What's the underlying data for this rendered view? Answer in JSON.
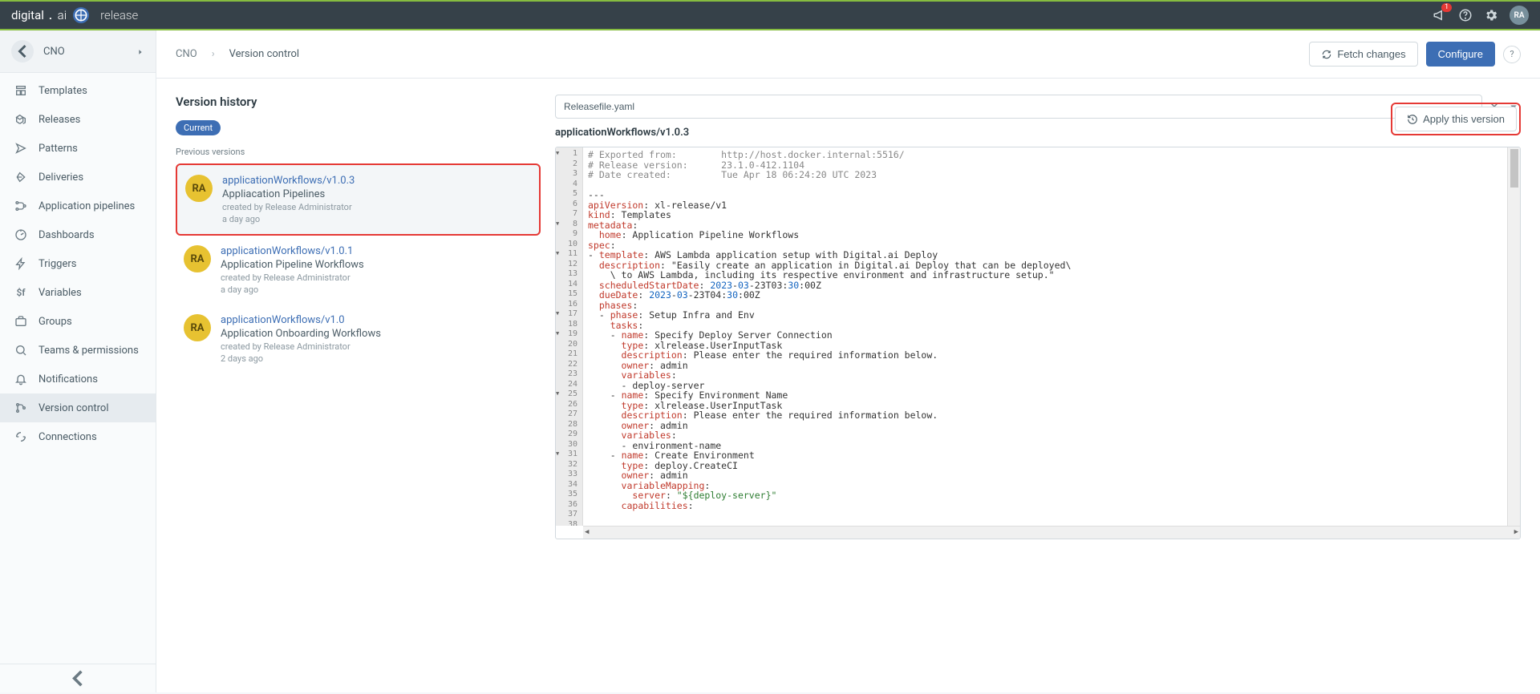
{
  "brand": {
    "product": "digital",
    "dot": ".",
    "ai": "ai",
    "module": "release"
  },
  "topbar": {
    "badge": "1",
    "avatar": "RA"
  },
  "project": {
    "name": "CNO"
  },
  "sidebar": {
    "items": [
      {
        "label": "Templates",
        "icon": "templates-icon"
      },
      {
        "label": "Releases",
        "icon": "releases-icon"
      },
      {
        "label": "Patterns",
        "icon": "patterns-icon"
      },
      {
        "label": "Deliveries",
        "icon": "deliveries-icon"
      },
      {
        "label": "Application pipelines",
        "icon": "pipelines-icon"
      },
      {
        "label": "Dashboards",
        "icon": "dashboards-icon"
      },
      {
        "label": "Triggers",
        "icon": "triggers-icon"
      },
      {
        "label": "Variables",
        "icon": "variables-icon"
      },
      {
        "label": "Groups",
        "icon": "groups-icon"
      },
      {
        "label": "Teams & permissions",
        "icon": "teams-icon"
      },
      {
        "label": "Notifications",
        "icon": "notifications-icon"
      },
      {
        "label": "Version control",
        "icon": "versioncontrol-icon"
      },
      {
        "label": "Connections",
        "icon": "connections-icon"
      }
    ]
  },
  "breadcrumb": {
    "root": "CNO",
    "page": "Version control"
  },
  "actions": {
    "fetch": "Fetch changes",
    "configure": "Configure",
    "apply": "Apply this version"
  },
  "history": {
    "title": "Version history",
    "current_pill": "Current",
    "prev_label": "Previous versions",
    "versions": [
      {
        "id": "applicationWorkflows/v1.0.3",
        "name": "Appliacation Pipelines",
        "created_by": "Release Administrator",
        "when": "a day ago",
        "initials": "RA"
      },
      {
        "id": "applicationWorkflows/v1.0.1",
        "name": "Application Pipeline Workflows",
        "created_by": "Release Administrator",
        "when": "a day ago",
        "initials": "RA"
      },
      {
        "id": "applicationWorkflows/v1.0",
        "name": "Application Onboarding Workflows",
        "created_by": "Release Administrator",
        "when": "2 days ago",
        "initials": "RA"
      }
    ],
    "created_by_prefix": "created by "
  },
  "file": {
    "name": "Releasefile.yaml",
    "path": "applicationWorkflows/v1.0.3",
    "lines": [
      "# Exported from:        http://host.docker.internal:5516/",
      "# Release version:      23.1.0-412.1104",
      "# Date created:         Tue Apr 18 06:24:20 UTC 2023",
      "",
      "---",
      "apiVersion: xl-release/v1",
      "kind: Templates",
      "metadata:",
      "  home: Application Pipeline Workflows",
      "spec:",
      "- template: AWS Lambda application setup with Digital.ai Deploy",
      "  description: \"Easily create an application in Digital.ai Deploy that can be deployed\\",
      "    \\ to AWS Lambda, including its respective environment and infrastructure setup.\"",
      "  scheduledStartDate: 2023-03-23T03:30:00Z",
      "  dueDate: 2023-03-23T04:30:00Z",
      "  phases:",
      "  - phase: Setup Infra and Env",
      "    tasks:",
      "    - name: Specify Deploy Server Connection",
      "      type: xlrelease.UserInputTask",
      "      description: Please enter the required information below.",
      "      owner: admin",
      "      variables:",
      "      - deploy-server",
      "    - name: Specify Environment Name",
      "      type: xlrelease.UserInputTask",
      "      description: Please enter the required information below.",
      "      owner: admin",
      "      variables:",
      "      - environment-name",
      "    - name: Create Environment",
      "      type: deploy.CreateCI",
      "      owner: admin",
      "      variableMapping:",
      "        server: \"${deploy-server}\"",
      "      capabilities:",
      "",
      ""
    ]
  }
}
